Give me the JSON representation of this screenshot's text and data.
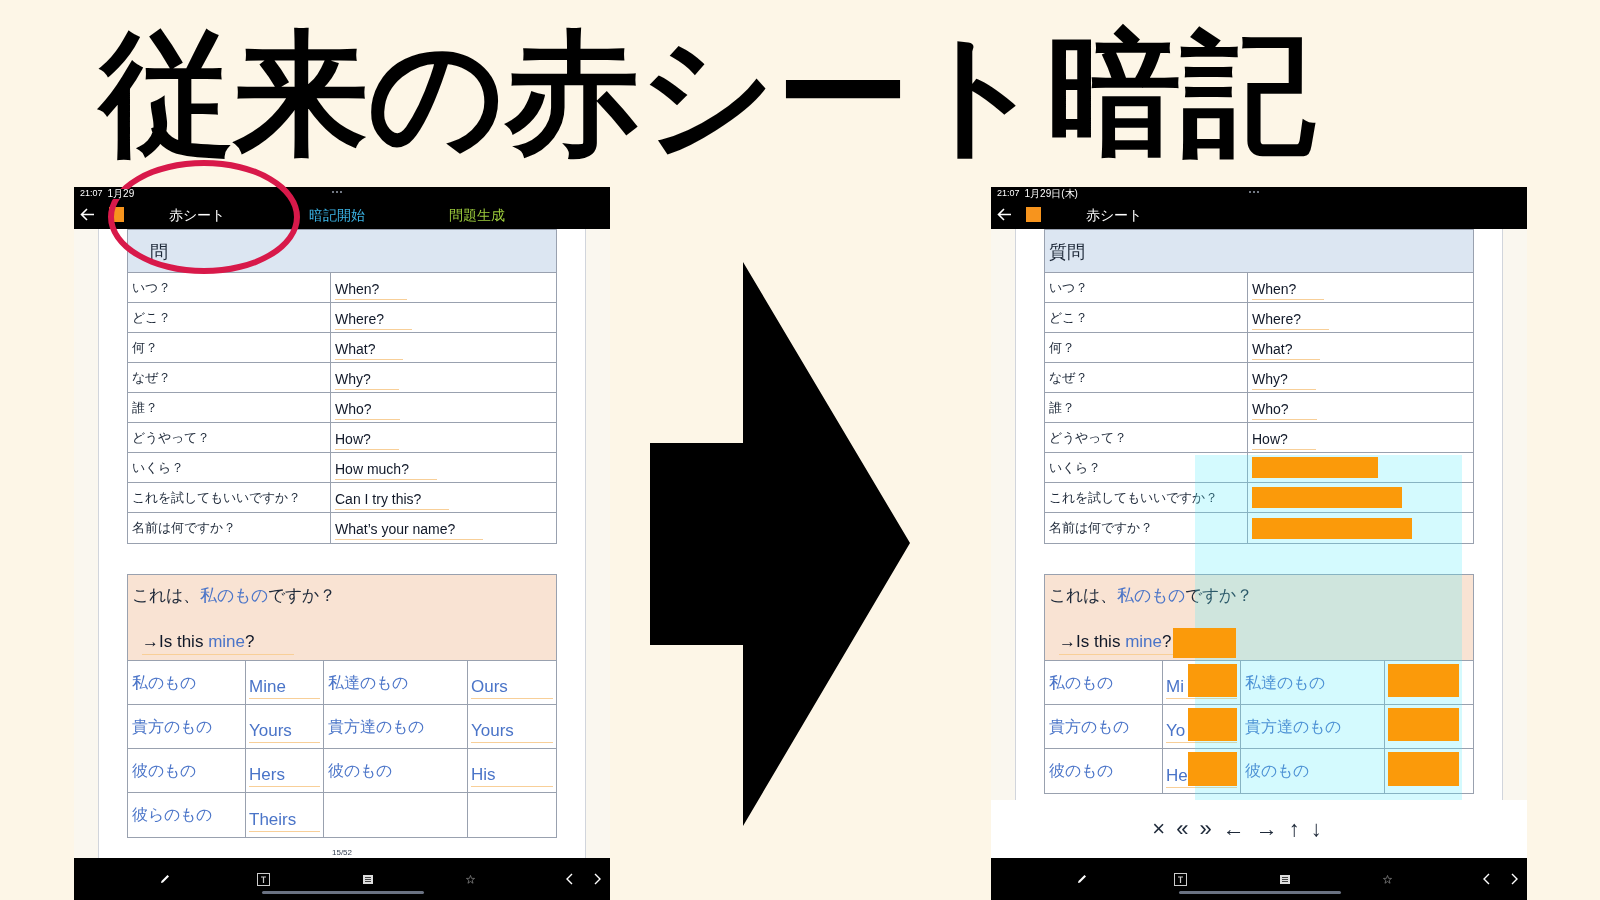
{
  "headline": "従来の赤シート暗記",
  "screens": [
    {
      "status_bar": {
        "time": "21:07",
        "date": "1月29"
      },
      "nav": {
        "title": "赤シート",
        "actions": [
          {
            "label": "暗記開始",
            "color": "#3bb4e6"
          },
          {
            "label": "問題生成",
            "color": "#9ccc3c"
          }
        ]
      },
      "sheet_visible": false,
      "question_table": {
        "header": "問",
        "rows": [
          {
            "question": "いつ？",
            "answer": "When?",
            "masked": false
          },
          {
            "question": "どこ？",
            "answer": "Where?",
            "masked": false
          },
          {
            "question": "何？",
            "answer": "What?",
            "masked": false
          },
          {
            "question": "なぜ？",
            "answer": "Why?",
            "masked": false
          },
          {
            "question": "誰？",
            "answer": "Who?",
            "masked": false
          },
          {
            "question": "どうやって？",
            "answer": "How?",
            "masked": false
          },
          {
            "question": "いくら？",
            "answer": "How much?",
            "masked": false
          },
          {
            "question": "これを試してもいいですか？",
            "answer": "Can I try this?",
            "masked": false
          },
          {
            "question": "名前は何ですか？",
            "answer": "What’s your name?",
            "masked": false
          }
        ]
      },
      "example": {
        "question_parts": [
          {
            "text": "これは、",
            "highlight": false
          },
          {
            "text": "私のもの",
            "highlight": true
          },
          {
            "text": "ですか？",
            "highlight": false
          }
        ],
        "answer_parts": [
          {
            "text": "→Is this ",
            "highlight": false
          },
          {
            "text": "mine",
            "highlight": true
          },
          {
            "text": "?",
            "highlight": false
          }
        ],
        "masked": false
      },
      "possessive_rows": [
        {
          "cells": [
            {
              "kind": "term",
              "text": "私のもの"
            },
            {
              "kind": "answer",
              "text": "Mine",
              "masked": false
            },
            {
              "kind": "term",
              "text": "私達のもの"
            },
            {
              "kind": "answer",
              "text": "Ours",
              "masked": false
            }
          ]
        },
        {
          "cells": [
            {
              "kind": "term",
              "text": "貴方のもの"
            },
            {
              "kind": "answer",
              "text": "Yours",
              "masked": false
            },
            {
              "kind": "term",
              "text": "貴方達のもの"
            },
            {
              "kind": "answer",
              "text": "Yours",
              "masked": false
            }
          ]
        },
        {
          "cells": [
            {
              "kind": "term",
              "text": "彼のもの"
            },
            {
              "kind": "answer",
              "text": "Hers",
              "masked": false
            },
            {
              "kind": "term",
              "text": "彼のもの"
            },
            {
              "kind": "answer",
              "text": "His",
              "masked": false
            }
          ]
        },
        {
          "cells": [
            {
              "kind": "term",
              "text": "彼らのもの"
            },
            {
              "kind": "answer",
              "text": "Theirs",
              "masked": false
            },
            {
              "kind": "blank"
            },
            {
              "kind": "blank"
            }
          ]
        }
      ],
      "page_number": "15/52"
    },
    {
      "status_bar": {
        "time": "21:07",
        "date": "1月29日(木)"
      },
      "nav": {
        "title": "赤シート"
      },
      "sheet_visible": true,
      "question_table": {
        "header": "質問",
        "rows": [
          {
            "question": "いつ？",
            "answer": "When?",
            "masked": false
          },
          {
            "question": "どこ？",
            "answer": "Where?",
            "masked": false
          },
          {
            "question": "何？",
            "answer": "What?",
            "masked": false
          },
          {
            "question": "なぜ？",
            "answer": "Why?",
            "masked": false
          },
          {
            "question": "誰？",
            "answer": "Who?",
            "masked": false
          },
          {
            "question": "どうやって？",
            "answer": "How?",
            "masked": false
          },
          {
            "question": "いくら？",
            "masked": true
          },
          {
            "question": "これを試してもいいですか？",
            "masked": true
          },
          {
            "question": "名前は何ですか？",
            "masked": true
          }
        ]
      },
      "example": {
        "question_parts": [
          {
            "text": "これは、",
            "highlight": false
          },
          {
            "text": "私のもの",
            "highlight": true
          },
          {
            "text": "ですか？",
            "highlight": false
          }
        ],
        "answer_parts": [
          {
            "text": "→Is this ",
            "highlight": false
          },
          {
            "text": "mine",
            "highlight": true
          },
          {
            "text": "?",
            "highlight": false
          }
        ],
        "masked": true
      },
      "possessive_rows": [
        {
          "cells": [
            {
              "kind": "term",
              "text": "私のもの"
            },
            {
              "kind": "answer",
              "text": "Mi",
              "masked": true
            },
            {
              "kind": "term",
              "text": "私達のもの"
            },
            {
              "kind": "answer",
              "masked": true
            }
          ]
        },
        {
          "cells": [
            {
              "kind": "term",
              "text": "貴方のもの"
            },
            {
              "kind": "answer",
              "text": "Yo",
              "masked": true
            },
            {
              "kind": "term",
              "text": "貴方達のもの"
            },
            {
              "kind": "answer",
              "masked": true
            }
          ]
        },
        {
          "cells": [
            {
              "kind": "term",
              "text": "彼のもの"
            },
            {
              "kind": "answer",
              "text": "He",
              "masked": true
            },
            {
              "kind": "term",
              "text": "彼のもの"
            },
            {
              "kind": "answer",
              "masked": true
            }
          ]
        }
      ],
      "controls": [
        "×",
        "«",
        "»",
        "←",
        "→",
        "↑",
        "↓"
      ]
    }
  ]
}
